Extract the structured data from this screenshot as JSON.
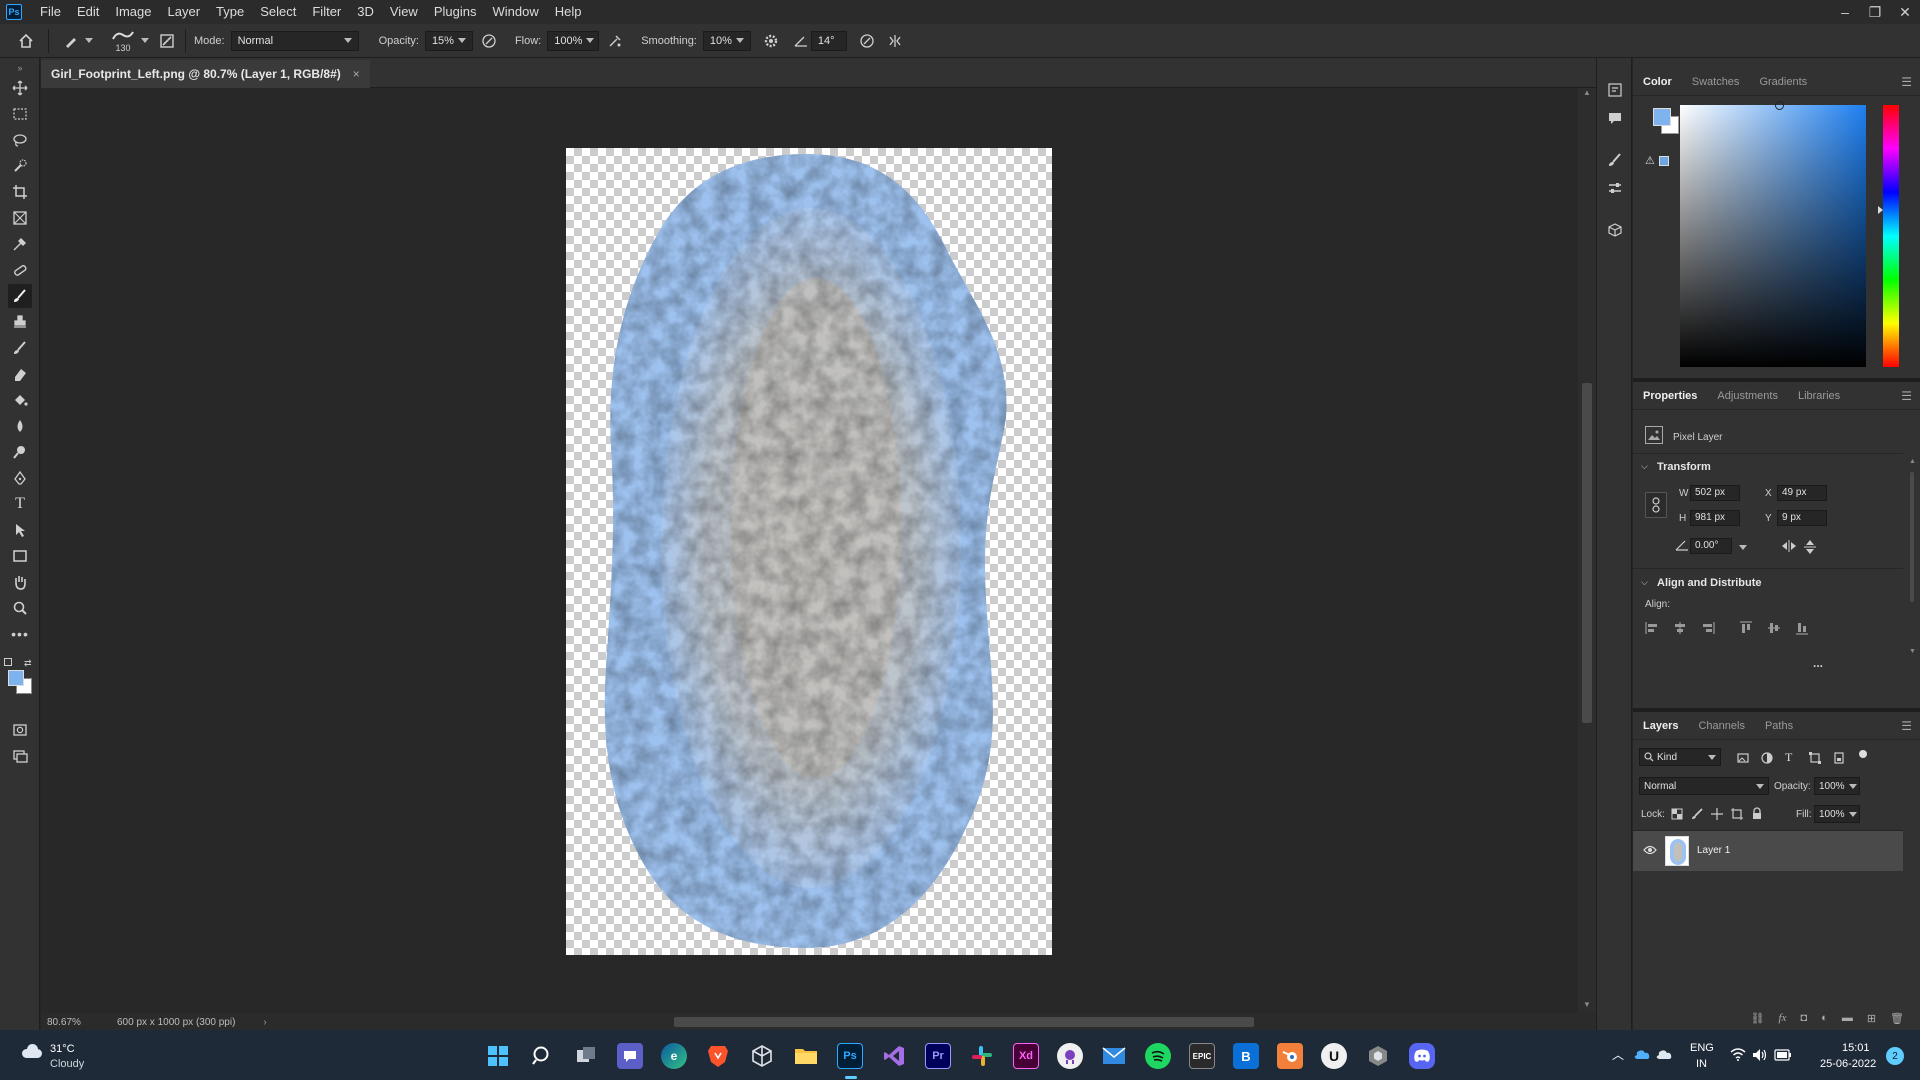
{
  "app": {
    "logo_text": "Ps"
  },
  "menu": [
    "File",
    "Edit",
    "Image",
    "Layer",
    "Type",
    "Select",
    "Filter",
    "3D",
    "View",
    "Plugins",
    "Window",
    "Help"
  ],
  "options": {
    "brush_size": "130",
    "mode_label": "Mode:",
    "mode_value": "Normal",
    "opacity_label": "Opacity:",
    "opacity_value": "15%",
    "flow_label": "Flow:",
    "flow_value": "100%",
    "smoothing_label": "Smoothing:",
    "smoothing_value": "10%",
    "angle_value": "14°"
  },
  "document": {
    "tab_title": "Girl_Footprint_Left.png @ 80.7% (Layer 1, RGB/8#)",
    "tab_close": "×"
  },
  "status": {
    "zoom": "80.67%",
    "doc_info": "600 px x 1000 px (300 ppi)"
  },
  "color_panel": {
    "tabs": [
      "Color",
      "Swatches",
      "Gradients"
    ],
    "foreground": "#7eb3ee",
    "background": "#ffffff"
  },
  "properties_panel": {
    "tabs": [
      "Properties",
      "Adjustments",
      "Libraries"
    ],
    "layer_type": "Pixel Layer",
    "transform_title": "Transform",
    "w_label": "W",
    "w_value": "502 px",
    "h_label": "H",
    "h_value": "981 px",
    "x_label": "X",
    "x_value": "49 px",
    "y_label": "Y",
    "y_value": "9 px",
    "angle_value": "0.00°",
    "align_title": "Align and Distribute",
    "align_label": "Align:",
    "more": "..."
  },
  "layers_panel": {
    "tabs": [
      "Layers",
      "Channels",
      "Paths"
    ],
    "filter_kind": "Kind",
    "blend_mode": "Normal",
    "opacity_label": "Opacity:",
    "opacity_value": "100%",
    "lock_label": "Lock:",
    "fill_label": "Fill:",
    "fill_value": "100%",
    "layers": [
      {
        "name": "Layer 1",
        "visible": true
      }
    ]
  },
  "taskbar": {
    "weather_temp": "31°C",
    "weather_desc": "Cloudy",
    "lang": "ENG",
    "region": "IN",
    "time": "15:01",
    "date": "25-06-2022",
    "notifications": "2"
  }
}
